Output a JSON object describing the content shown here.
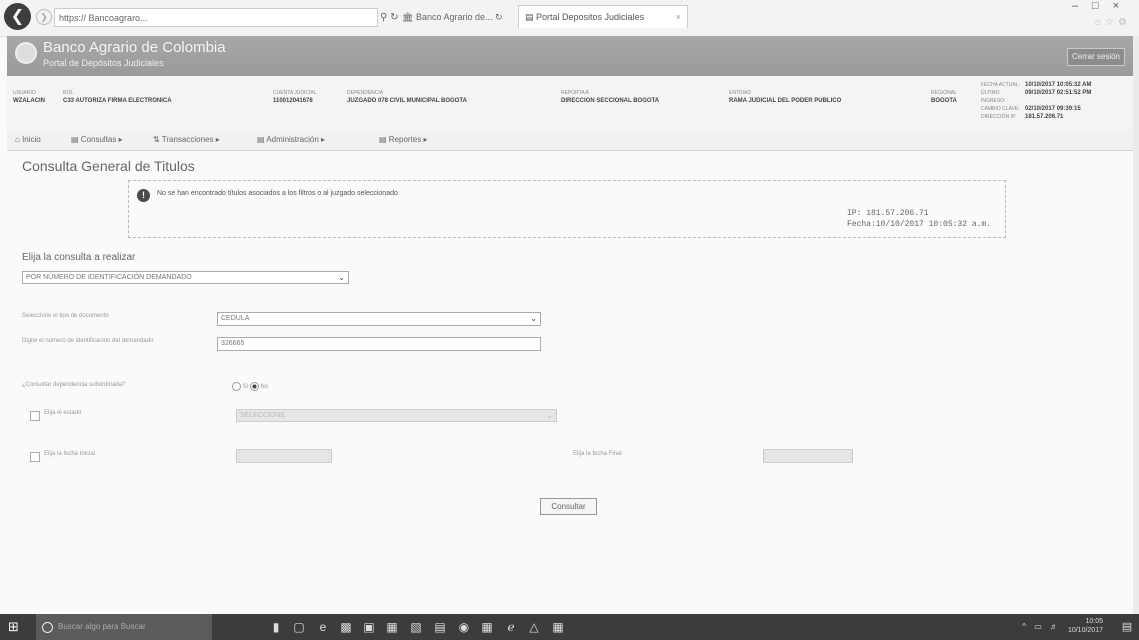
{
  "browser": {
    "address": "https://",
    "address_extra": "Bancoagraro...",
    "tab1_title": "Banco Agrario de...",
    "tab2_title": "Portal Depositos Judiciales"
  },
  "header": {
    "brand": "Banco Agrario de Colombia",
    "subtitle": "Portal de Depósitos Judiciales",
    "logout_label": "Cerrar sesión"
  },
  "info": {
    "usuario_label": "USUARIO",
    "usuario_value": "WZALACIN",
    "rol_label": "ROL",
    "rol_value": "C33 AUTORIZA FIRMA ELECTRONICA",
    "cuenta_label": "CUENTA JUDICIAL",
    "cuenta_value": "110012041678",
    "dependencia_label": "DEPENDENCIA",
    "dependencia_value": "JUZGADO 078 CIVIL MUNICIPAL BOGOTA",
    "reporta_label": "REPORTA A",
    "reporta_value": "DIRECCION SECCIONAL BOGOTA",
    "entidad_label": "ENTIDAD",
    "entidad_value": "RAMA JUDICIAL DEL PODER PUBLICO",
    "regional_label": "REGIONAL",
    "regional_value": "BOGOTA",
    "right": [
      {
        "label": "FECHA ACTUAL:",
        "value": "10/10/2017 10:05:32 AM"
      },
      {
        "label": "ÚLTIMO INGRESO:",
        "value": "09/10/2017 02:51:52 PM"
      },
      {
        "label": "CAMBIO CLAVE:",
        "value": "02/10/2017 09:39:15"
      },
      {
        "label": "DIRECCIÓN IP:",
        "value": "181.57.206.71"
      }
    ]
  },
  "nav": {
    "inicio": "Inicio",
    "consultas": "Consultas",
    "transacciones": "Transacciones",
    "administracion": "Administración",
    "reportes": "Reportes"
  },
  "main": {
    "title": "Consulta General de Titulos",
    "message": "No se han encontrado títulos asociados a los filtros o al juzgado seleccionado",
    "ip_line": "IP:   181.57.206.71",
    "fecha_line": "Fecha:10/10/2017 10:05:32 a.m.",
    "consulta_label": "Elija la consulta a realizar",
    "consulta_value": "POR NÚMERO DE IDENTIFICACIÓN DEMANDADO",
    "tipo_doc_label": "Seleccione el tipo de documento",
    "tipo_doc_value": "CEDULA",
    "num_id_label": "Digite el número de identificación del demandado",
    "num_id_value": "326665",
    "dependencia_q": "¿Consultar dependencia subordinada?",
    "radio_si": "Si",
    "radio_no": "No",
    "estado_label": "Elija el estado",
    "estado_value": "SELECCIONE",
    "fecha_ini_label": "Elija la fecha Inicial",
    "fecha_fin_label": "Elija la fecha Final",
    "submit_label": "Consultar"
  },
  "taskbar": {
    "search_placeholder": "Buscar algo para Buscar",
    "time": "10:05",
    "date": "10/10/2017"
  }
}
